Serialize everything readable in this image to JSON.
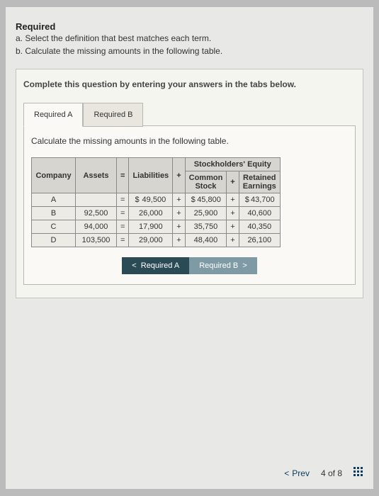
{
  "header": {
    "title": "Required",
    "line_a": "a. Select the definition that best matches each term.",
    "line_b": "b. Calculate the missing amounts in the following table."
  },
  "card": {
    "instruction": "Complete this question by entering your answers in the tabs below.",
    "tabs": {
      "a": "Required A",
      "b": "Required B"
    },
    "tab_desc": "Calculate the missing amounts in the following table."
  },
  "table": {
    "headers": {
      "company": "Company",
      "assets": "Assets",
      "eq": "=",
      "liabilities": "Liabilities",
      "plus": "+",
      "se_group": "Stockholders' Equity",
      "common": "Common Stock",
      "retained": "Retained Earnings"
    },
    "rows": [
      {
        "company": "A",
        "assets": "",
        "liabilities": "49,500",
        "common": "45,800",
        "retained": "43,700",
        "dollar": true
      },
      {
        "company": "B",
        "assets": "92,500",
        "liabilities": "26,000",
        "common": "25,900",
        "retained": "40,600",
        "dollar": false
      },
      {
        "company": "C",
        "assets": "94,000",
        "liabilities": "17,900",
        "common": "35,750",
        "retained": "40,350",
        "dollar": false
      },
      {
        "company": "D",
        "assets": "103,500",
        "liabilities": "29,000",
        "common": "48,400",
        "retained": "26,100",
        "dollar": false
      }
    ]
  },
  "nav": {
    "req_a": "Required A",
    "req_b": "Required B",
    "lt": "<",
    "gt": ">"
  },
  "footer": {
    "prev": "Prev",
    "page": "4 of 8"
  }
}
